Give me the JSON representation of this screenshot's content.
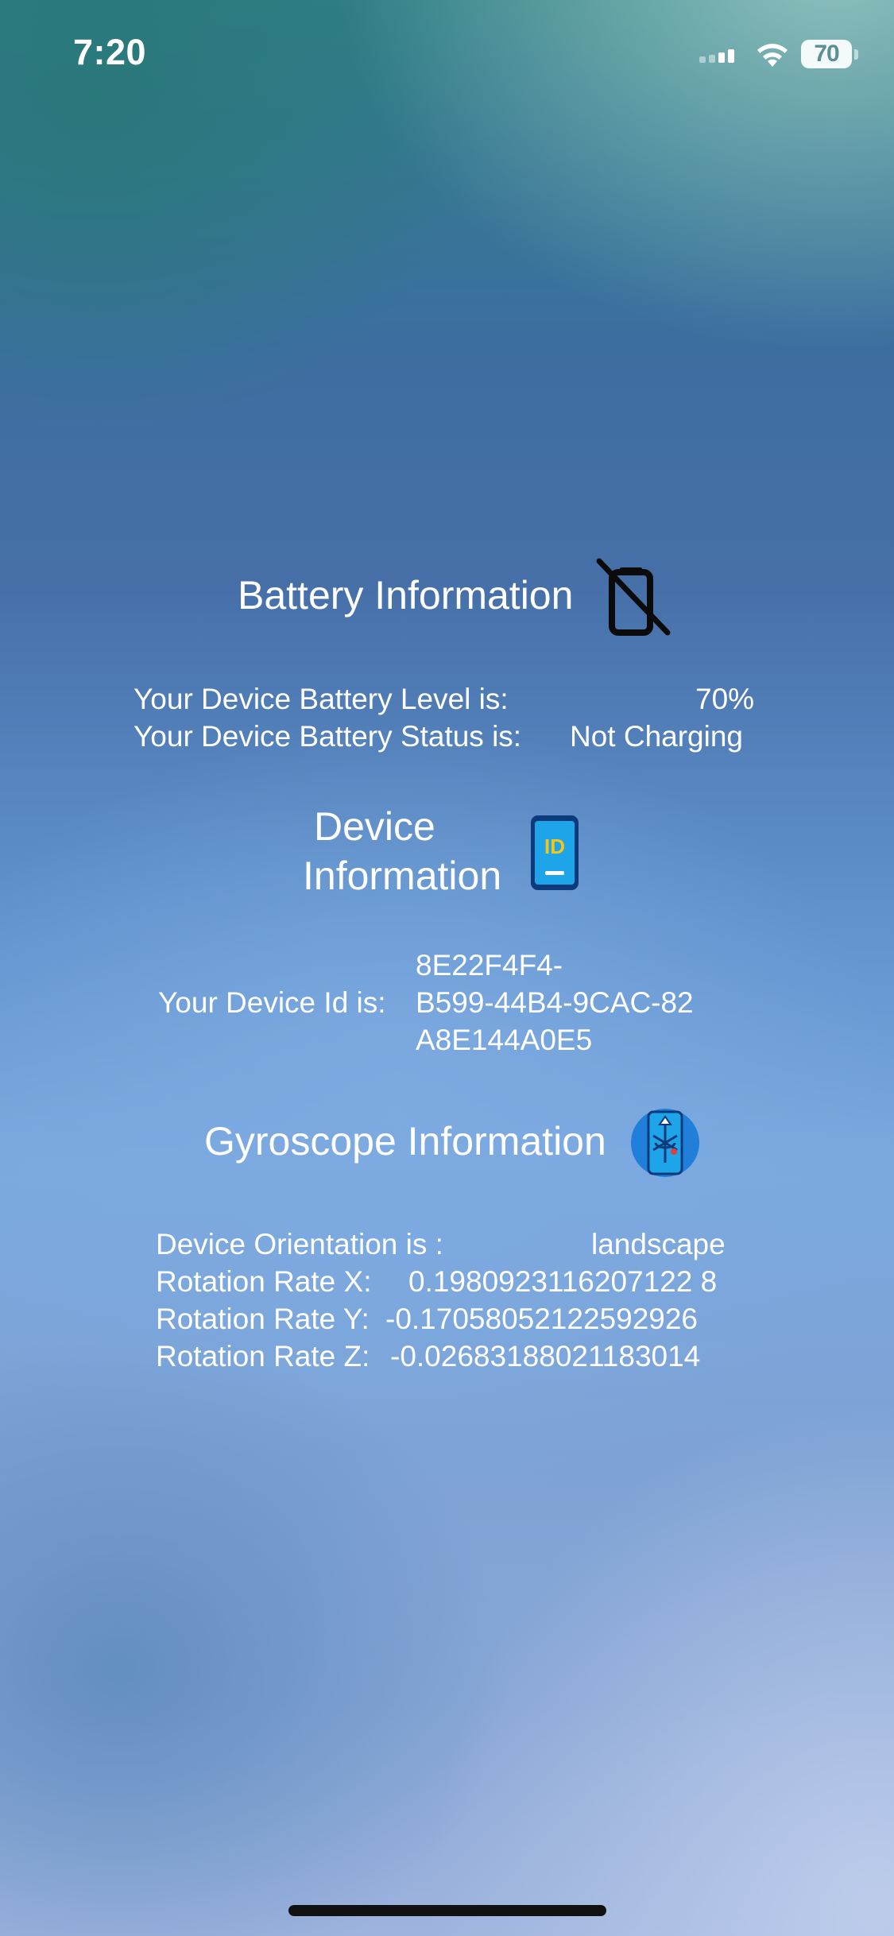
{
  "status_bar": {
    "time": "7:20",
    "battery_percent": "70",
    "signal_bars_active": 2,
    "signal_bars_total": 4
  },
  "battery_section": {
    "title": "Battery Information",
    "icon": "battery-slash-icon",
    "level_label": "Your Device Battery Level is:",
    "level_value": "70%",
    "status_label": "Your Device Battery Status is:",
    "status_value": "Not Charging"
  },
  "device_section": {
    "title_line1": "Device",
    "title_line2": "Information",
    "icon": "phone-id-icon",
    "id_label": "Your Device Id is:",
    "id_value_lines": [
      "8E22F4F4-",
      "B599-44B4-9CAC-82",
      "A8E144A0E5"
    ]
  },
  "gyroscope_section": {
    "title": "Gyroscope Information",
    "icon": "gyroscope-phone-icon",
    "orientation_label": "Device Orientation is :",
    "orientation_value": "landscape",
    "rate_x_label": "Rotation Rate X:",
    "rate_x_value": "0.1980923116207122 8",
    "rate_y_label": "Rotation Rate Y:",
    "rate_y_value": "-0.17058052122592926",
    "rate_z_label": "Rotation Rate Z:",
    "rate_z_value": "-0.02683188021183014"
  },
  "colors": {
    "text": "#ffffff",
    "id_badge": "#f5c518",
    "phone_screen": "#1ea5e9"
  }
}
